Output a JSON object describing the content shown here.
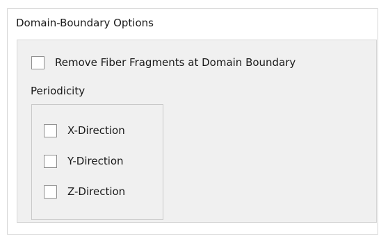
{
  "panel": {
    "title": "Domain-Boundary Options"
  },
  "remove_fragments": {
    "label": "Remove Fiber Fragments at Domain Boundary",
    "checked": false
  },
  "periodicity": {
    "label": "Periodicity",
    "options": [
      {
        "label": "X-Direction",
        "checked": false
      },
      {
        "label": "Y-Direction",
        "checked": false
      },
      {
        "label": "Z-Direction",
        "checked": false
      }
    ]
  }
}
